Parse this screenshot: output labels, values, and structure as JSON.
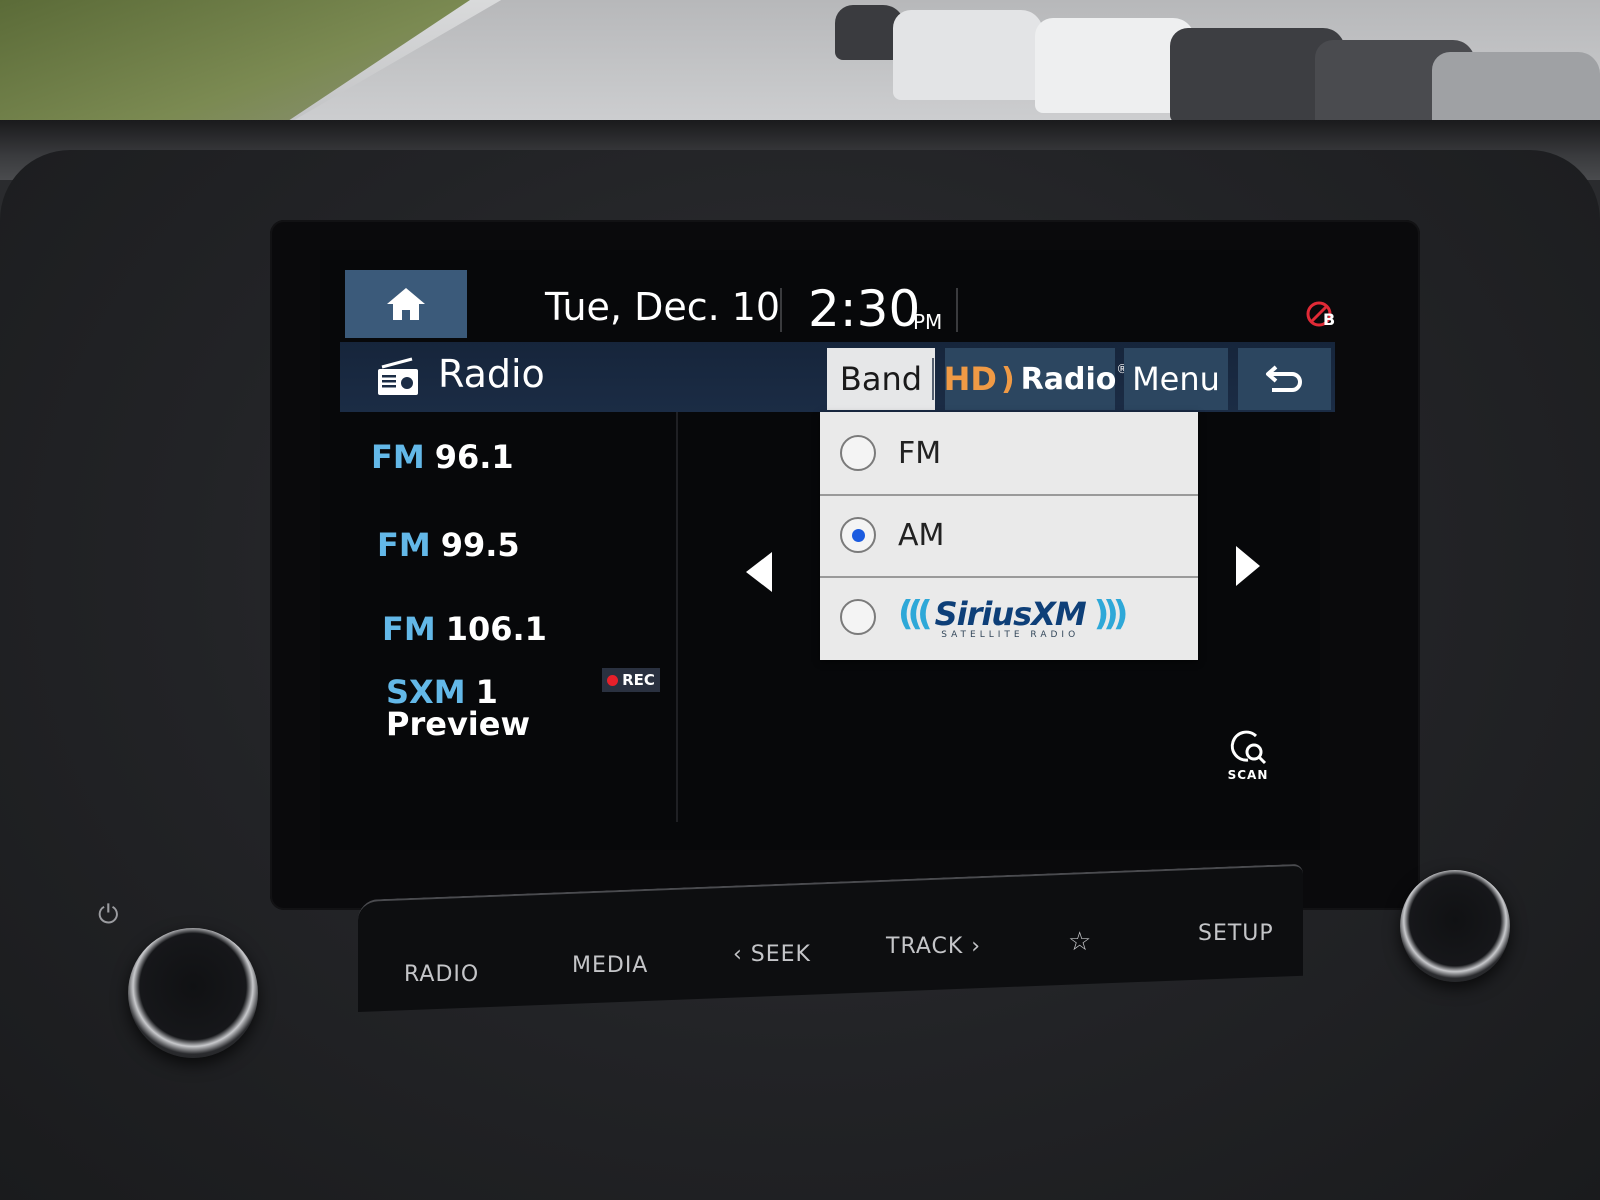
{
  "status_bar": {
    "home_label": "Home",
    "date": "Tue, Dec. 10",
    "time": "2:30",
    "ampm": "PM",
    "bluetooth_status_icon": "bluetooth-disconnected-icon",
    "bluetooth_letter": "B"
  },
  "header": {
    "icon": "radio-icon",
    "title": "Radio",
    "buttons": {
      "band": "Band",
      "hd_logo": "HD",
      "hd_text": "Radio",
      "hd_reg": "®",
      "menu": "Menu",
      "back_icon": "back-arrow-icon"
    }
  },
  "presets": [
    {
      "band": "FM",
      "value": "96.1"
    },
    {
      "band": "FM",
      "value": "99.5"
    },
    {
      "band": "FM",
      "value": "106.1"
    },
    {
      "band": "SXM",
      "value": "1",
      "subtitle": "Preview"
    }
  ],
  "rec_badge": "REC",
  "band_dropdown": {
    "options": [
      {
        "label": "FM",
        "selected": false
      },
      {
        "label": "AM",
        "selected": true
      },
      {
        "label": "SiriusXM",
        "sublabel": "SATELLITE RADIO",
        "selected": false
      }
    ],
    "selected_color": "#1c5ce0"
  },
  "scan_label": "SCAN",
  "hardware_buttons": [
    "RADIO",
    "MEDIA",
    "‹ SEEK",
    "TRACK ›",
    "☆",
    "SETUP"
  ],
  "colors": {
    "accent_blue": "#63b8e8",
    "hd_orange": "#f09a45",
    "header_bg": "#1b2c45",
    "button_bg": "#2c4660",
    "rec_red": "#e8202a"
  }
}
